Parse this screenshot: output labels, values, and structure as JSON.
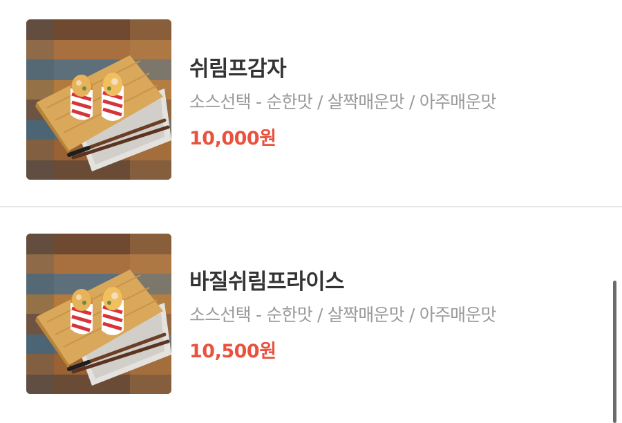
{
  "menu": {
    "items": [
      {
        "name": "쉬림프감자",
        "description": "소스선택 - 순한맛 / 살짝매운맛 / 아주매운맛",
        "price": "10,000원",
        "image": "shrimp-wrap-photo"
      },
      {
        "name": "바질쉬림프라이스",
        "description": "소스선택 - 순한맛 / 살짝매운맛 / 아주매운맛",
        "price": "10,500원",
        "image": "shrimp-wrap-photo"
      }
    ]
  },
  "colors": {
    "price": "#e9523f",
    "name": "#333333",
    "description": "#9a9a9a",
    "divider": "#e6e6e6"
  }
}
